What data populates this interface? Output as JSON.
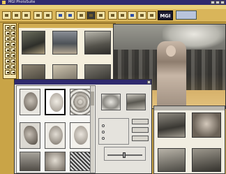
{
  "window": {
    "title": "MGI PhotoSuite"
  },
  "toolbar": {
    "logo": "MGI"
  },
  "dialog": {
    "radio_labels": [
      "",
      "",
      ""
    ]
  },
  "icons": {
    "app": "app-icon",
    "minimize": "minimize-icon",
    "maximize": "maximize-icon",
    "close": "close-icon"
  }
}
